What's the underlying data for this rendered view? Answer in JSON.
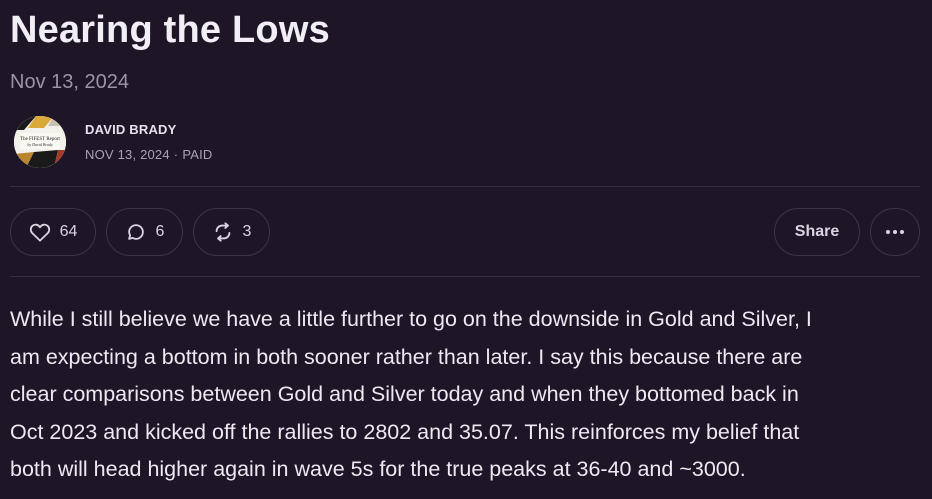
{
  "post": {
    "title": "Nearing the Lows",
    "date": "Nov 13, 2024"
  },
  "author": {
    "name": "DAVID BRADY",
    "date": "NOV 13, 2024",
    "separator": "·",
    "access": "PAID",
    "avatar_text_line1": "The FIFEST Report",
    "avatar_text_line2": "by David Brady"
  },
  "actions": {
    "like_count": "64",
    "comment_count": "6",
    "restack_count": "3",
    "share_label": "Share",
    "more_label": "•••",
    "icons": [
      "heart-icon",
      "comment-icon",
      "restack-icon",
      "more-icon"
    ]
  },
  "body": {
    "lines": [
      "While I still believe we have a little further to go on the downside in Gold and Silver, I",
      "am expecting a bottom in both sooner rather than later. I say this because there are",
      "clear comparisons between Gold and Silver today and when they bottomed back in",
      "Oct 2023 and kicked off the rallies to 2802 and 35.07. This reinforces my belief that",
      "both will head higher again in wave 5s for the true peaks at 36-40 and ~3000."
    ]
  },
  "colors": {
    "background": "#1e1627",
    "text": "#ece9f1",
    "muted": "#9b93a6",
    "border": "#3d3448"
  }
}
